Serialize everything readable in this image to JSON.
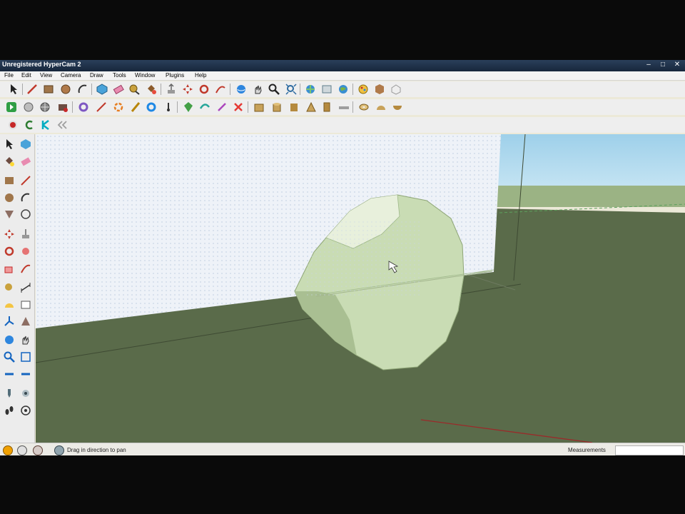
{
  "window": {
    "title": "Unregistered HyperCam 2"
  },
  "menu": [
    "File",
    "Edit",
    "View",
    "Camera",
    "Draw",
    "Tools",
    "Window",
    "Plugins",
    "Help"
  ],
  "status": {
    "hint": "Drag in direction to pan",
    "measurements_label": "Measurements",
    "measurements_value": ""
  },
  "colors": {
    "sky": "#9ed0ea",
    "ground": "#5a6b4a",
    "sphere": "#c9dcb4",
    "titlebar": "#1c2e47"
  }
}
